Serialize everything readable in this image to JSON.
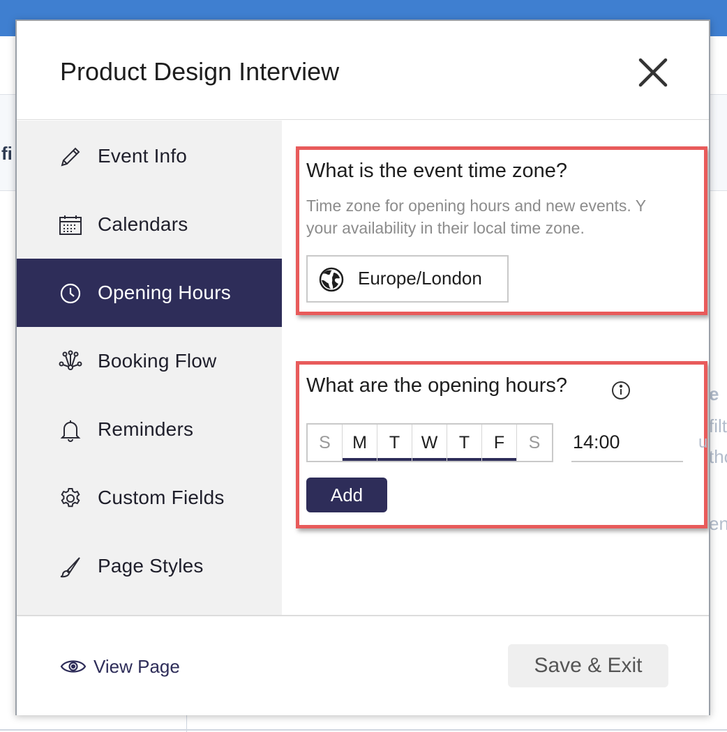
{
  "modal": {
    "title": "Product Design Interview",
    "close_icon": "close-icon"
  },
  "sidebar": {
    "items": [
      {
        "label": "Event Info",
        "icon": "pencil-icon",
        "active": false
      },
      {
        "label": "Calendars",
        "icon": "calendar-icon",
        "active": false
      },
      {
        "label": "Opening Hours",
        "icon": "clock-icon",
        "active": true
      },
      {
        "label": "Booking Flow",
        "icon": "flow-icon",
        "active": false
      },
      {
        "label": "Reminders",
        "icon": "bell-icon",
        "active": false
      },
      {
        "label": "Custom Fields",
        "icon": "gear-icon",
        "active": false
      },
      {
        "label": "Page Styles",
        "icon": "brush-icon",
        "active": false
      }
    ]
  },
  "timezone": {
    "question": "What is the event time zone?",
    "help_line1": "Time zone for opening hours and new events. Y",
    "help_line2": "your availability in their local time zone.",
    "value": "Europe/London"
  },
  "opening_hours": {
    "question": "What are the opening hours?",
    "days": [
      {
        "letter": "S",
        "selected": false
      },
      {
        "letter": "M",
        "selected": true
      },
      {
        "letter": "T",
        "selected": true
      },
      {
        "letter": "W",
        "selected": true
      },
      {
        "letter": "T",
        "selected": true
      },
      {
        "letter": "F",
        "selected": true
      },
      {
        "letter": "S",
        "selected": false
      }
    ],
    "time": "14:00",
    "add_label": "Add"
  },
  "footer": {
    "view_page_label": "View Page",
    "save_label": "Save & Exit"
  },
  "background": {
    "frag_left": "fi",
    "frag_right_1": "e",
    "frag_right_2": "filt",
    "frag_right_3": "tho",
    "frag_right_4": "en",
    "frag_time_tail": "u"
  },
  "colors": {
    "accent": "#2e2d59",
    "highlight_border": "#e85b5b",
    "topbar": "#3f7fd0"
  }
}
